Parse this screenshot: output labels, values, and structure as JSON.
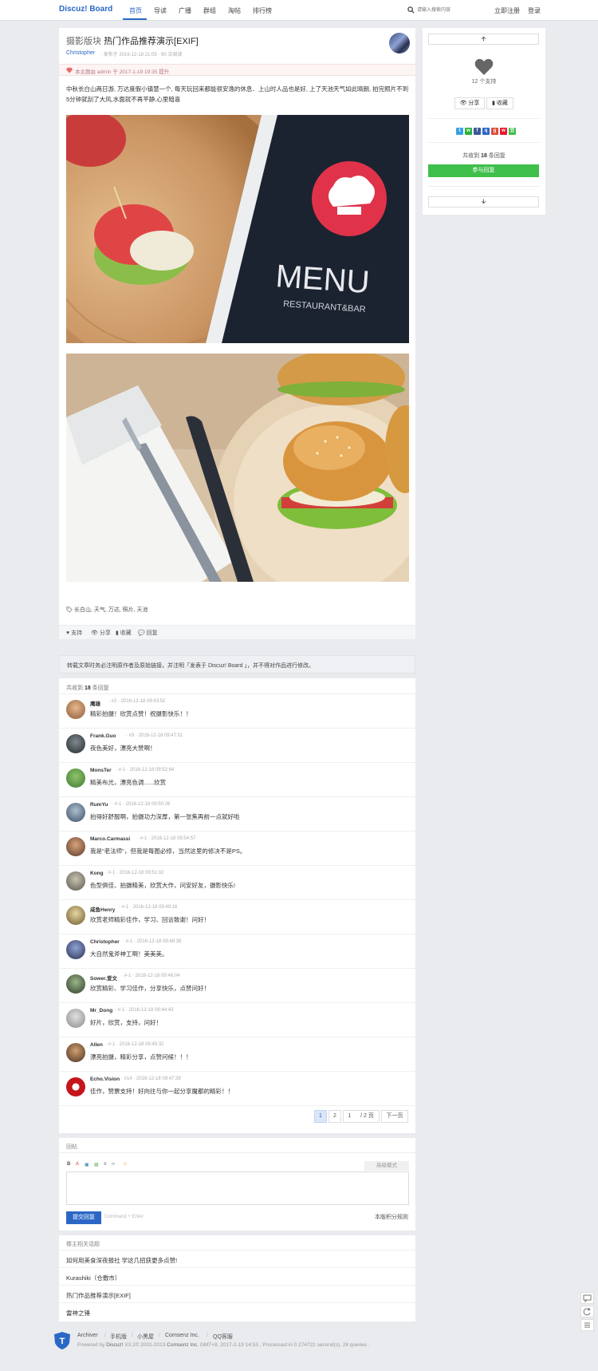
{
  "nav": {
    "logo": "Discuz! Board",
    "items": [
      "首页",
      "导读",
      "广播",
      "群组",
      "淘帖",
      "排行榜"
    ],
    "search_placeholder": "请输入搜索内容",
    "register": "立即注册",
    "login": "登录"
  },
  "post": {
    "forum": "摄影版块",
    "title": "热门作品推荐演示[EXIF]",
    "author": "Christopher",
    "meta": "· 发布于 2016-12-18 21:05 · 90 次阅读",
    "notice": "本主题由 admin 于 2017-1-19 19:35 提升",
    "body": "中秋长白山两日游, 万达度假小镇慧一个, 每天玩回来都能很安逸的休息．上山时人品也是好, 上了天池天气如此晴朗, 拍完照片不到5分钟就刮了大风,水面就不再平静,心里暗喜",
    "menu_title": "MENU",
    "menu_sub": "RESTAURANT&BAR",
    "tags": "长白山, 天气, 万达, 照片, 天池",
    "actions": [
      "支持",
      "分享",
      "收藏",
      "回复"
    ]
  },
  "repost_note": "转载文章时务必注明原作者及原始链接，并注明「发表于 Discuz! Board 」，并不得对作品进行修改。",
  "replies": {
    "header_prefix": "共收到",
    "count": "18",
    "header_suffix": "条回复",
    "items": [
      {
        "name": "鹰雄",
        "meta": "· #2 · 2016-12-18 09:43:52",
        "content": "精彩拍摄！欣赏点赞！祝摄影快乐！！"
      },
      {
        "name": "Frank.Guo",
        "meta": "· #3 · 2016-12-18 09:47:01",
        "content": "夜色美好，漂亮大赞啊！"
      },
      {
        "name": "MonsTer",
        "meta": "· #-1 · 2016-12-18 09:52:64",
        "content": "精美布光，漂亮色调......欣赏"
      },
      {
        "name": "RumYu",
        "meta": "· #-1 · 2016-12-18 09:50:26",
        "content": "拍得好舒服啊，拍摄功力深厚，第一张焦再前一点就好啦"
      },
      {
        "name": "Marco.Carmassi",
        "meta": "· #-1 · 2016-12-18 09:54:57",
        "content": "我是\"老法师\"，但我是每图必修，当然这里的修决不是PS。"
      },
      {
        "name": "Kong",
        "meta": "· #-1 · 2016-12-18 09:51:02",
        "content": "色型俱佳、拍摄精美，欣赏大作，问安好友，摄影快乐!"
      },
      {
        "name": "咸鱼Henry",
        "meta": "· #-1 · 2016-12-18 09:49:16",
        "content": "欣赏老师精彩佳作，学习、回访致谢！问好！"
      },
      {
        "name": "Christopher",
        "meta": "· #-1 · 2016-12-18 09:48:38",
        "content": "大自然鬼斧神工啊！美美美。"
      },
      {
        "name": "Sower.爱文",
        "meta": "· #-1 · 2016-12-18 09:46:04",
        "content": "欣赏精彩、学习佳作，分享快乐，点赞问好！"
      },
      {
        "name": "Mr_Dong",
        "meta": "· #-1 · 2016-12-18 09:44:43",
        "content": "好片，欣赏，支持，问好！"
      },
      {
        "name": "Allen",
        "meta": "· #-1 · 2016-12-18 09:45:32",
        "content": "漂亮拍摄，精彩分享，点赞问候！！！"
      },
      {
        "name": "Echo.Vision",
        "meta": "· #14 · 2016-12-18 09:47:39",
        "content": "佳作，赞票支持！好向往与你一起分享魔都的精彩！！"
      }
    ],
    "pager": [
      "1",
      "2",
      "1",
      "/ 2 页",
      "下一页"
    ]
  },
  "editor": {
    "title": "回帖",
    "toolbar": [
      "B",
      "A",
      "▣",
      "▤",
      "≡",
      "‹›",
      "☺"
    ],
    "advanced": "高级模式",
    "submit": "提交回复",
    "shortcut": "Command + Enter",
    "rules": "本版积分规则"
  },
  "related": {
    "title": "楼主相关话题",
    "items": [
      "如何用美食深夜报社 学这几招获更多点赞!",
      "Kurashiki（仓敷市）",
      "热门作品推荐演示[EXIF]",
      "雷神之锤"
    ]
  },
  "footer": {
    "links": [
      "Archiver",
      "手机版",
      "小黑屋",
      "Comsenz Inc.",
      "QQ客服"
    ],
    "powered_prefix": "Powered by",
    "powered_brand": "Discuz!",
    "powered_mid": "X3.2© 2001-2013",
    "powered_company": "Comsenz Inc.",
    "powered_suffix": "GMT+8, 2017-2-19 14:53 , Processed in 0.274722 second(s), 28 queries ."
  },
  "sidebar": {
    "up": "🡩",
    "down": "🡫",
    "support_count": "12 个支持",
    "share": "分享",
    "favorite": "收藏",
    "reply_prefix": "共收到",
    "reply_count": "18",
    "reply_suffix": "条回复",
    "join": "参与回复"
  },
  "colors": {
    "brand": "#2b67c6",
    "join_button": "#3fbf4b",
    "background": "#e9ebee"
  }
}
